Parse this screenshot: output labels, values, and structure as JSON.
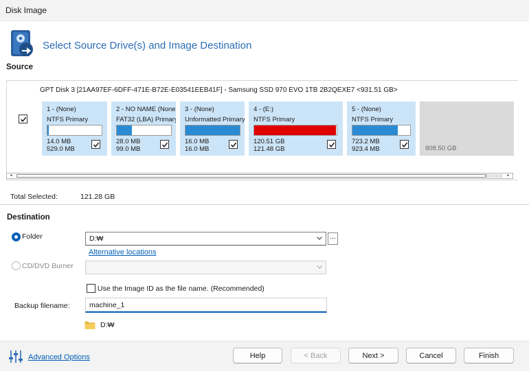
{
  "window": {
    "title": "Disk Image"
  },
  "header": {
    "title": "Select Source Drive(s) and Image Destination",
    "icon": "disk-image-icon"
  },
  "source": {
    "label": "Source",
    "disk_header": "GPT Disk 3 [21AA97EF-6DFF-471E-B72E-E03541EEB41F] - Samsung SSD 970 EVO 1TB 2B2QEXE7  <931.51 GB>",
    "disk_checked": true,
    "partitions": [
      {
        "name": "1 -  (None)",
        "fs": "NTFS Primary",
        "used": "14.0 MB",
        "total": "529.0 MB",
        "fill_fraction": 0.03,
        "fill_color": "#2a8ad4",
        "checked": true
      },
      {
        "name": "2 - NO NAME (None)",
        "fs": "FAT32 (LBA) Primary",
        "used": "28.0 MB",
        "total": "99.0 MB",
        "fill_fraction": 0.28,
        "fill_color": "#2a8ad4",
        "checked": true
      },
      {
        "name": "3 -  (None)",
        "fs": "Unformatted Primary",
        "used": "16.0 MB",
        "total": "16.0 MB",
        "fill_fraction": 1.0,
        "fill_color": "#2a8ad4",
        "checked": true
      },
      {
        "name": "4 -  (E:)",
        "fs": "NTFS Primary",
        "used": "120.51 GB",
        "total": "121.48 GB",
        "fill_fraction": 0.99,
        "fill_color": "#e00000",
        "checked": true
      },
      {
        "name": "5 -  (None)",
        "fs": "NTFS Primary",
        "used": "723.2 MB",
        "total": "923.4 MB",
        "fill_fraction": 0.78,
        "fill_color": "#2a8ad4",
        "checked": true
      }
    ],
    "unallocated": "808.50 GB",
    "total_selected_label": "Total Selected:",
    "total_selected_value": "121.28 GB"
  },
  "destination": {
    "label": "Destination",
    "folder_label": "Folder",
    "folder_selected": true,
    "folder_value": "D:₩",
    "browse_label": "...",
    "alt_locations": "Alternative locations",
    "cd_label": "CD/DVD Burner",
    "cd_value": "",
    "use_image_id_label": "Use the Image ID as the file name.  (Recommended)",
    "use_image_id_checked": false,
    "backup_filename_label": "Backup filename:",
    "backup_filename_value": "machine_1",
    "path_display": "D:₩"
  },
  "footer": {
    "advanced_options": "Advanced Options",
    "buttons": {
      "help": "Help",
      "back": "< Back",
      "next": "Next >",
      "cancel": "Cancel",
      "finish": "Finish"
    }
  },
  "colors": {
    "accent": "#005fb8",
    "partition_bg": "#cce4f7",
    "used_normal": "#2a8ad4",
    "used_full": "#e00000"
  }
}
